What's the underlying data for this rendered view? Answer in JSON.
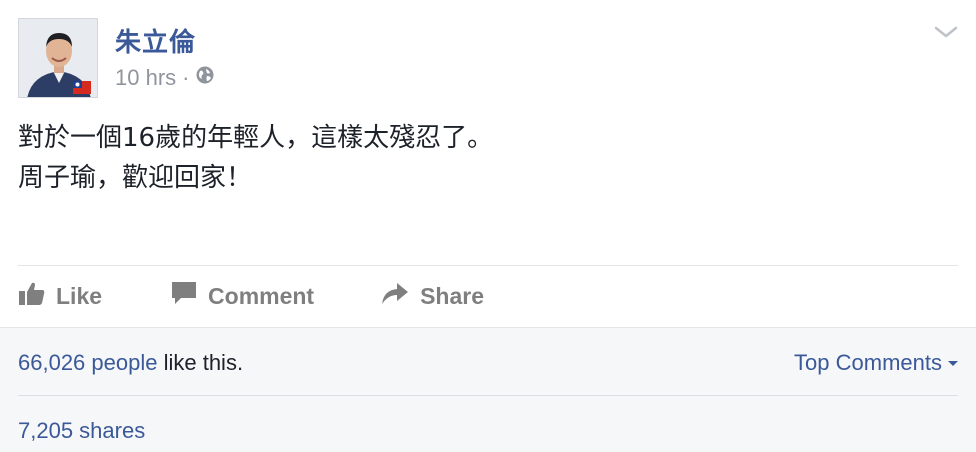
{
  "post": {
    "author_name": "朱立倫",
    "timestamp": "10 hrs",
    "separator": "·",
    "privacy_icon": "globe-icon",
    "menu_icon": "chevron-down-icon",
    "body_lines": [
      "對於一個16歲的年輕人，這樣太殘忍了。",
      "周子瑜，歡迎回家！"
    ]
  },
  "actions": {
    "like_label": "Like",
    "comment_label": "Comment",
    "share_label": "Share"
  },
  "reactions": {
    "likes_count": "66,026 people",
    "likes_suffix": " like this.",
    "top_comments_label": "Top Comments",
    "shares_label": "7,205 shares"
  },
  "colors": {
    "link": "#3b5998",
    "muted": "#90949c",
    "action": "#7f7f7f",
    "footer_bg": "#f6f7f9"
  }
}
